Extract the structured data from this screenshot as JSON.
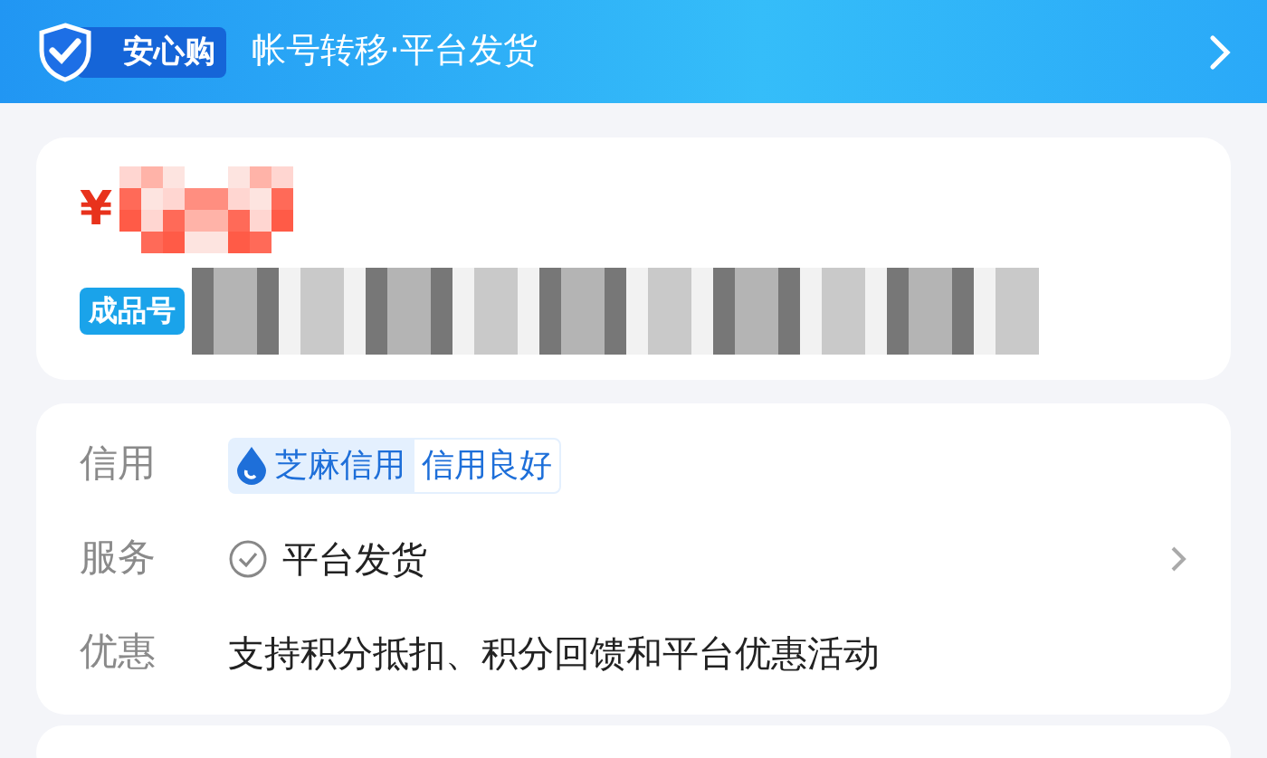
{
  "banner": {
    "badge": "安心购",
    "title": "帐号转移·平台发货"
  },
  "price": {
    "currency": "¥"
  },
  "product": {
    "tag": "成品号"
  },
  "details": [
    {
      "kind": "credit",
      "label": "信用",
      "badge_primary": "芝麻信用",
      "badge_secondary": "信用良好"
    },
    {
      "kind": "service",
      "label": "服务",
      "value": "平台发货"
    },
    {
      "kind": "text",
      "label": "优惠",
      "value": "支持积分抵扣、积分回馈和平台优惠活动"
    }
  ]
}
